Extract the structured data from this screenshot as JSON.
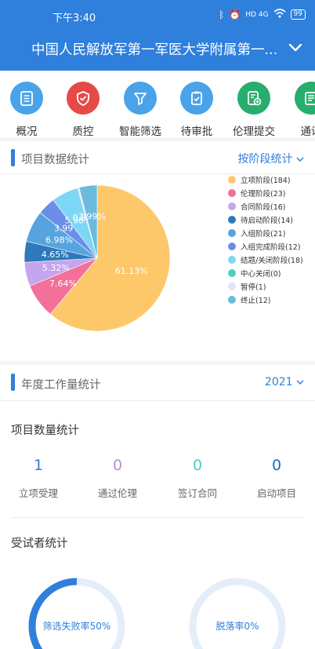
{
  "status": {
    "time": "下午3:40",
    "network": "HD 4G",
    "battery": "99"
  },
  "header": {
    "hospital": "中国人民解放军第一军医大学附属第一..."
  },
  "shortcuts": [
    "概况",
    "质控",
    "智能筛选",
    "待审批",
    "伦理提交",
    "通讯"
  ],
  "project_stats": {
    "title": "项目数据统计",
    "filter": "按阶段统计"
  },
  "chart_data": {
    "type": "pie",
    "title": "",
    "series": [
      {
        "name": "立项阶段(184)",
        "value": 184,
        "percent_label": "61.13%",
        "color": "#fcc86a"
      },
      {
        "name": "伦理阶段(23)",
        "value": 23,
        "percent_label": "7.64%",
        "color": "#f2709a"
      },
      {
        "name": "合同阶段(16)",
        "value": 16,
        "percent_label": "5.32%",
        "color": "#c6a5ef"
      },
      {
        "name": "待启动阶段(14)",
        "value": 14,
        "percent_label": "4.65%",
        "color": "#2f79bb"
      },
      {
        "name": "入组阶段(21)",
        "value": 21,
        "percent_label": "6.98%",
        "color": "#56a4df"
      },
      {
        "name": "入组完成阶段(12)",
        "value": 12,
        "percent_label": "3.99%",
        "color": "#6b8ee8"
      },
      {
        "name": "结题/关闭阶段(18)",
        "value": 18,
        "percent_label": "5.98%",
        "color": "#7ed6f5"
      },
      {
        "name": "中心关闭(0)",
        "value": 0,
        "percent_label": "",
        "color": "#4ecfbe"
      },
      {
        "name": "暂停(1)",
        "value": 1,
        "percent_label": "0.33%",
        "color": "#dfe7f6"
      },
      {
        "name": "终止(12)",
        "value": 12,
        "percent_label": "3.99%",
        "color": "#6bbcdc"
      }
    ]
  },
  "workload": {
    "title": "年度工作量统计",
    "year": "2021",
    "project_count_title": "项目数量统计",
    "stats": [
      {
        "value": "1",
        "label": "立项受理"
      },
      {
        "value": "0",
        "label": "通过伦理"
      },
      {
        "value": "0",
        "label": "签订合同"
      },
      {
        "value": "0",
        "label": "启动项目"
      }
    ],
    "subjects_title": "受试者统计",
    "gauges": [
      {
        "label": "筛选失败率50%",
        "value": 0.5
      },
      {
        "label": "脱落率0%",
        "value": 0
      }
    ]
  }
}
